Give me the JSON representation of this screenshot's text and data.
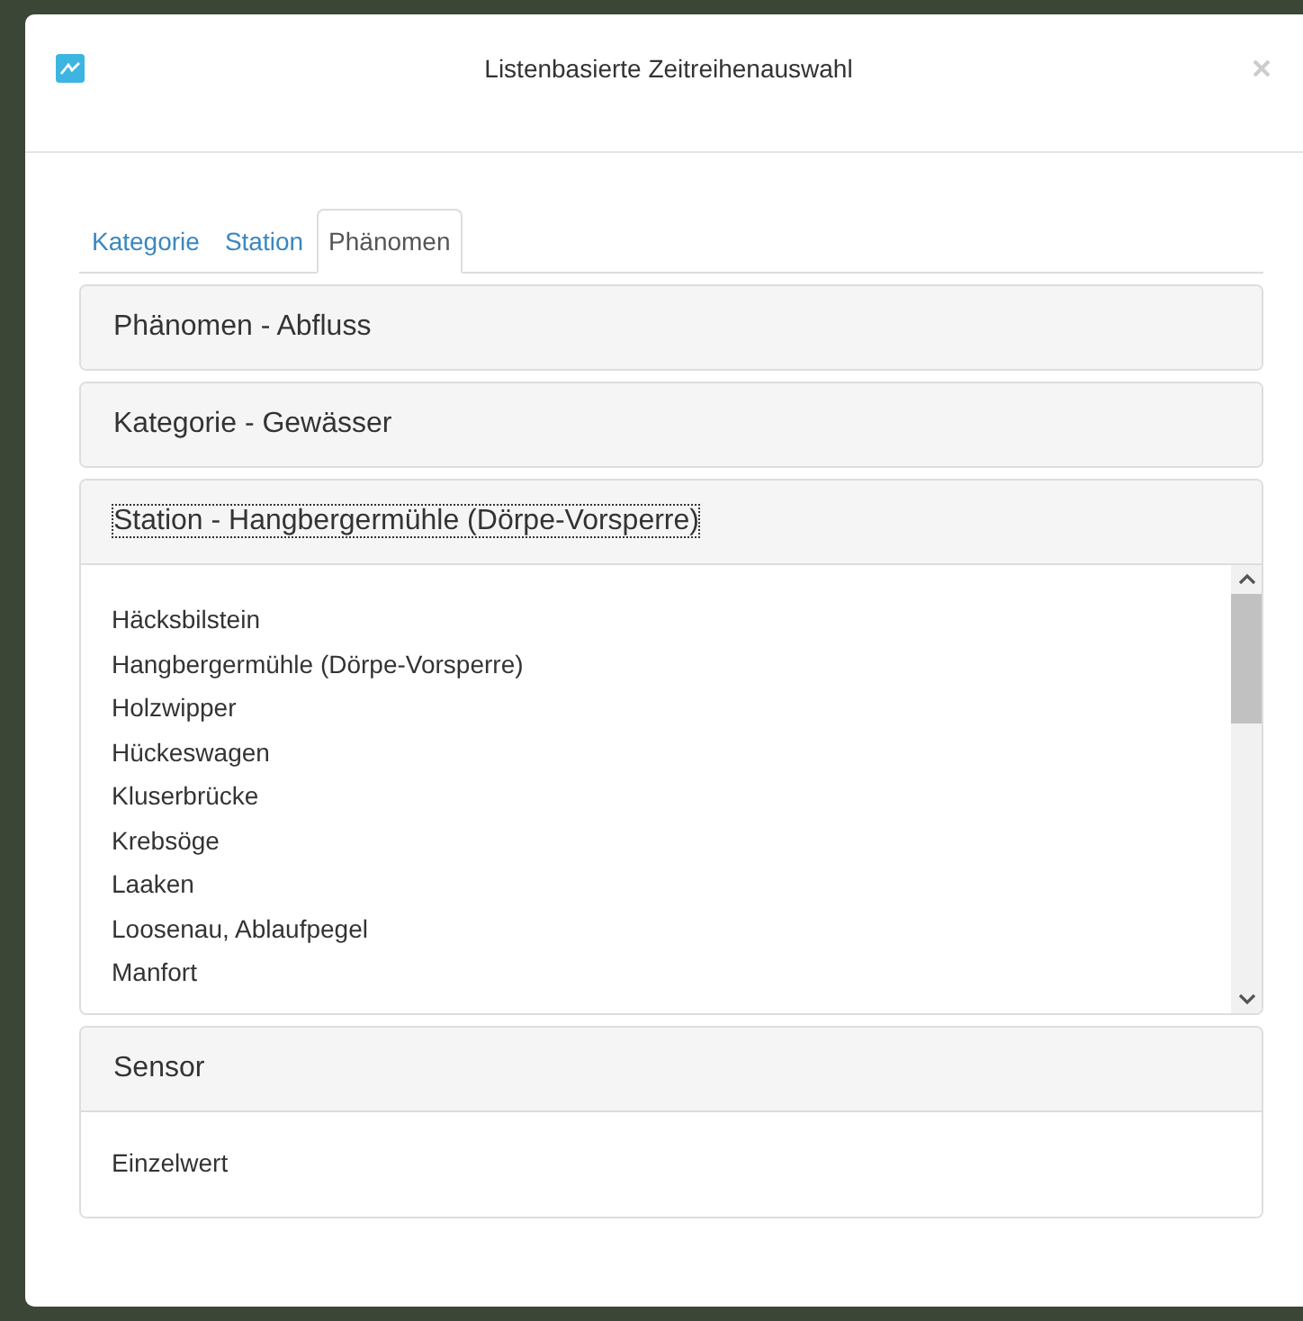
{
  "window": {
    "title": "Listenbasierte Zeitreihenauswahl"
  },
  "tabs": [
    {
      "label": "Kategorie",
      "selected": false
    },
    {
      "label": "Station",
      "selected": false
    },
    {
      "label": "Phänomen",
      "selected": true
    }
  ],
  "panels": [
    {
      "title": "Phänomen - Abfluss",
      "expanded": false,
      "focused": false
    },
    {
      "title": "Kategorie - Gewässer",
      "expanded": false,
      "focused": false
    },
    {
      "title": "Station - Hangbergermühle (Dörpe-Vorsperre)",
      "expanded": true,
      "focused": true,
      "scrollable": true,
      "items": [
        "Häcksbilstein",
        "Hangbergermühle (Dörpe-Vorsperre)",
        "Holzwipper",
        "Hückeswagen",
        "Kluserbrücke",
        "Krebsöge",
        "Laaken",
        "Loosenau, Ablaufpegel",
        "Manfort"
      ]
    },
    {
      "title": "Sensor",
      "expanded": true,
      "focused": false,
      "scrollable": false,
      "items": [
        "Einzelwert"
      ]
    }
  ]
}
